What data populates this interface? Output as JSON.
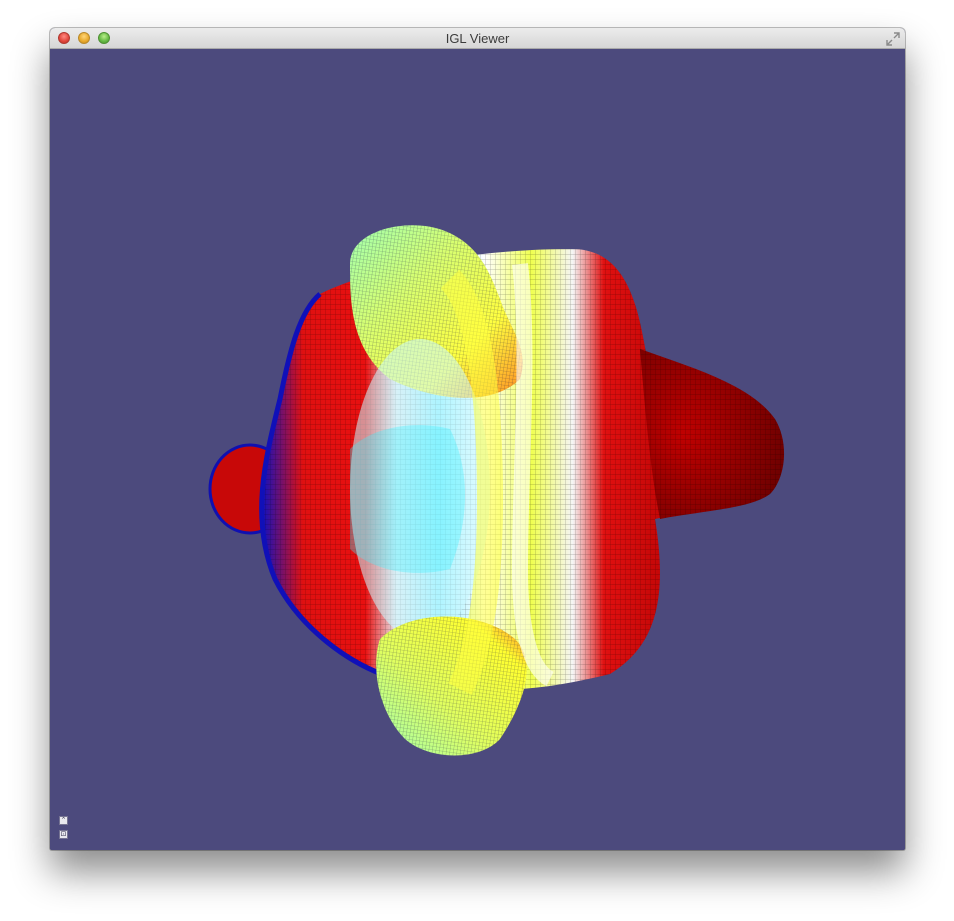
{
  "window": {
    "title": "IGL Viewer"
  },
  "titlebar": {
    "buttons": [
      "close-button",
      "minimize-button",
      "zoom-button"
    ],
    "fullscreen_icon": "fullscreen-arrows-icon"
  },
  "viewport": {
    "background_color": "#4c4a7d",
    "colormap": [
      "#0000b0",
      "#00ffff",
      "#ffffff",
      "#ffff00",
      "#ff0000",
      "#7a0000"
    ],
    "render_mode": "wireframe-colormapped-mesh"
  },
  "toolbar": {
    "expand_button_icon": "chevron-up-icon",
    "expand_button_glyph": "⌃",
    "settings_button_icon": "options-icon",
    "settings_button_glyph": "⊡"
  }
}
